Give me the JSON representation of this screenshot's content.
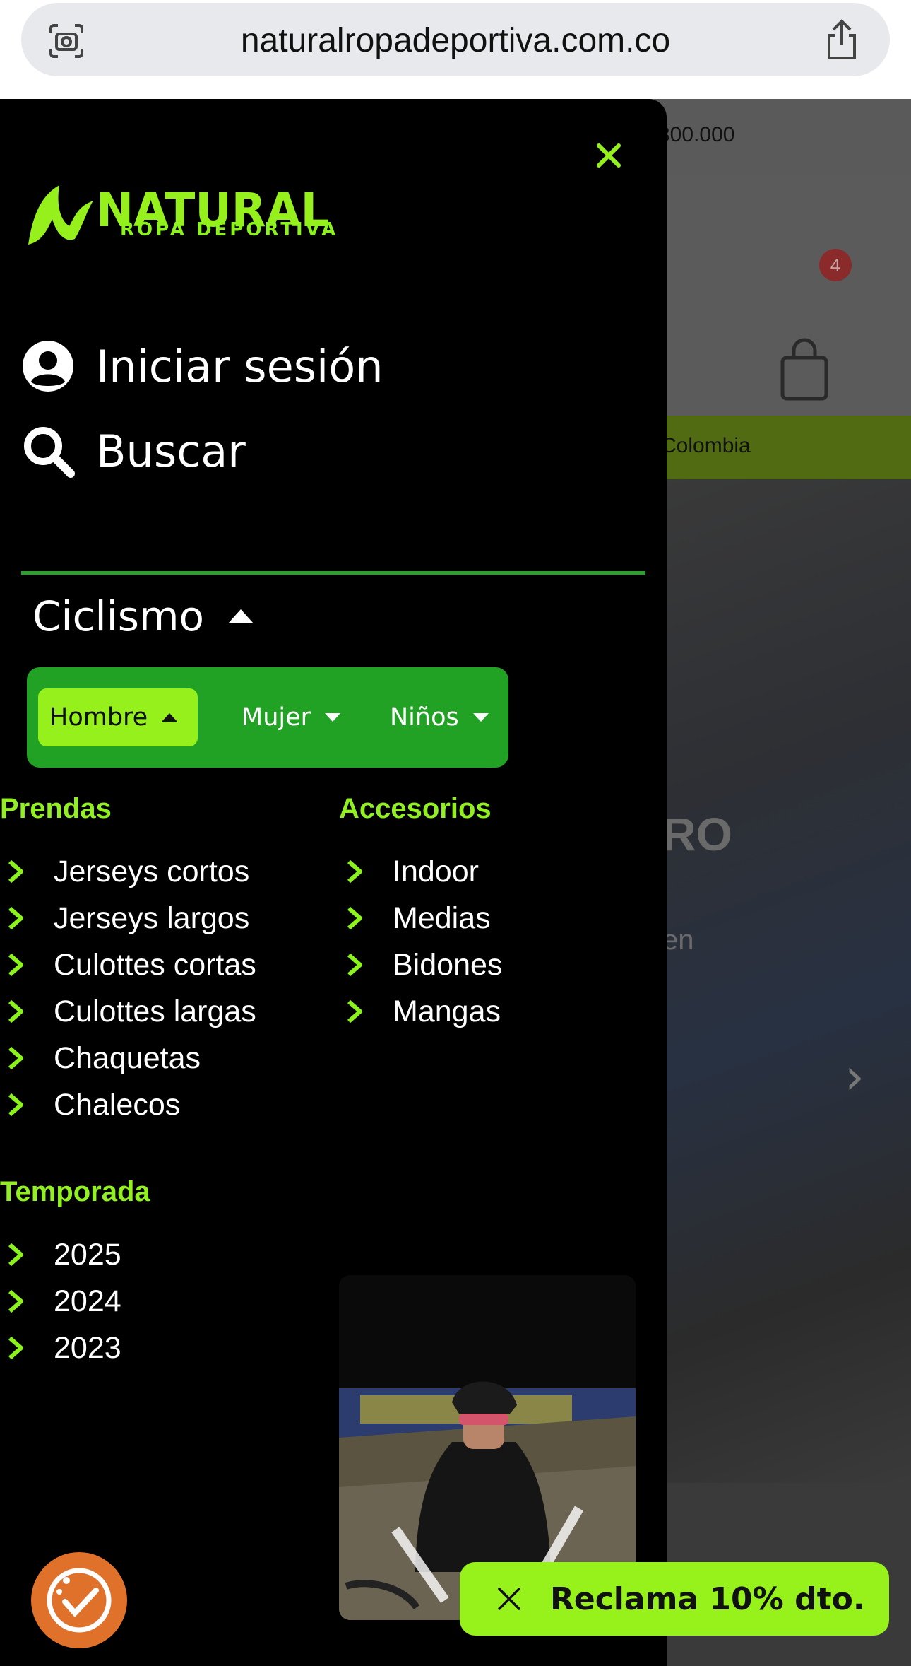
{
  "browser": {
    "url": "naturalropadeportiva.com.co"
  },
  "background_page": {
    "topbar_text": "300.000",
    "cart_count": "4",
    "greenbar_text": "Colombia",
    "hero_partial_title": "RO",
    "hero_partial_text": "en"
  },
  "drawer": {
    "logo": {
      "wordmark": "NATURAL",
      "tagline": "ROPA DEPORTIVA"
    },
    "account": [
      {
        "label": "Iniciar sesión",
        "icon": "user-circle-icon"
      },
      {
        "label": "Buscar",
        "icon": "search-icon"
      }
    ],
    "section": {
      "label": "Ciclismo"
    },
    "tabs": [
      {
        "label": "Hombre",
        "active": true
      },
      {
        "label": "Mujer",
        "active": false
      },
      {
        "label": "Niños",
        "active": false
      }
    ],
    "prendas": {
      "title": "Prendas",
      "items": [
        "Jerseys cortos",
        "Jerseys largos",
        "Culottes cortas",
        "Culottes largas",
        "Chaquetas",
        "Chalecos"
      ]
    },
    "accesorios": {
      "title": "Accesorios",
      "items": [
        "Indoor",
        "Medias",
        "Bidones",
        "Mangas"
      ]
    },
    "temporada": {
      "title": "Temporada",
      "items": [
        "2025",
        "2024",
        "2023"
      ]
    }
  },
  "claim": {
    "label": "Reclama 10% dto."
  },
  "colors": {
    "brand_green": "#96f01b",
    "tab_green": "#22a224",
    "cookie_orange": "#e0712b"
  }
}
